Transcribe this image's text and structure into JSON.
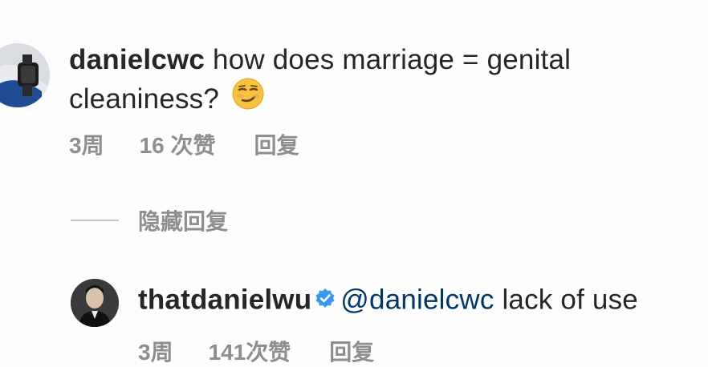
{
  "comments": [
    {
      "username": "danielcwc",
      "text": "how does marriage = genital cleaniness?",
      "emoji": "smirk-emoji",
      "time": "3周",
      "likes": "16 次赞",
      "reply": "回复"
    }
  ],
  "hide_replies": "隐藏回复",
  "replies": [
    {
      "username": "thatdanielwu",
      "verified": true,
      "mention": "@danielcwc",
      "text": "lack of use",
      "time": "3周",
      "likes": "141次赞",
      "reply": "回复"
    }
  ],
  "colors": {
    "text": "#262626",
    "meta": "#8e8e8e",
    "mention": "#00376b",
    "verified": "#3897f0"
  }
}
